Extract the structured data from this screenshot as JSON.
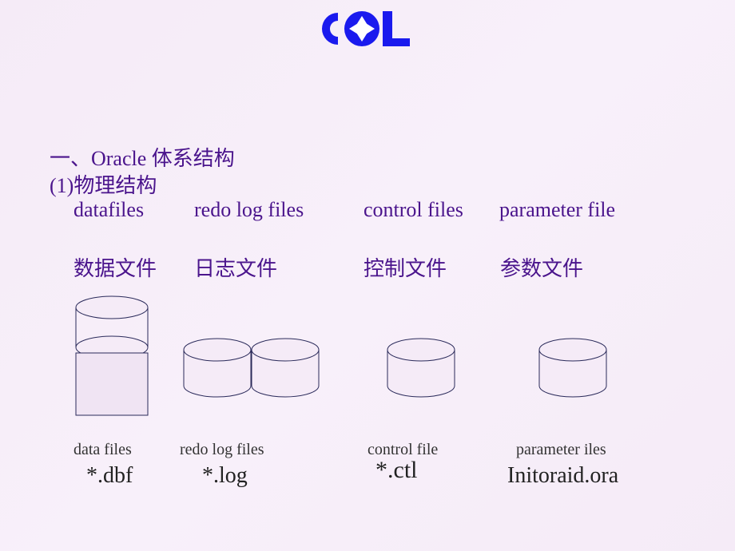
{
  "heading1": "一、Oracle 体系结构",
  "heading2": "(1)物理结构",
  "columns": {
    "datafiles": {
      "english": "datafiles",
      "chinese": "数据文件",
      "small_label": "data files",
      "extension": "*.dbf"
    },
    "redolog": {
      "english": "redo log files",
      "chinese": "日志文件",
      "small_label": "redo log files",
      "extension": "*.log"
    },
    "control": {
      "english": "control  files",
      "chinese": "控制文件",
      "small_label": "control file",
      "extension": "*.ctl"
    },
    "parameter": {
      "english": "parameter  file",
      "chinese": "参数文件",
      "small_label": "parameter iles",
      "extension": "Initoraid.ora"
    }
  }
}
